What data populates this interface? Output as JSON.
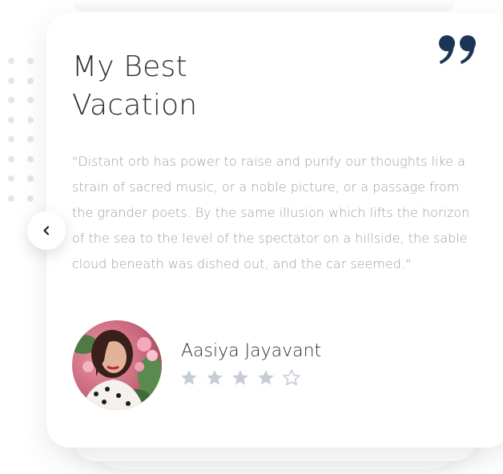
{
  "testimonial": {
    "title_line1": "My Best",
    "title_line2": "Vacation",
    "quote": "\"Distant orb has power to raise and purify our thoughts like a strain of sacred music, or a noble picture, or a passage from the grander poets. By the same illusion which lifts the horizon of the sea to the level of the spectator on a hillside, the sable cloud beneath was dished out, and the car seemed.\"",
    "author": "Aasiya Jayavant",
    "rating": {
      "value": 4,
      "max": 5
    },
    "quote_icon": "quote-marks-icon",
    "prev_icon": "chevron-left-icon"
  },
  "colors": {
    "accent": "#1c3557",
    "title": "#2b2f36",
    "body_text": "#9a9fa8",
    "star_filled": "#c6ccd6",
    "star_empty": "#c6ccd6",
    "dots": "#e3e6ea"
  }
}
